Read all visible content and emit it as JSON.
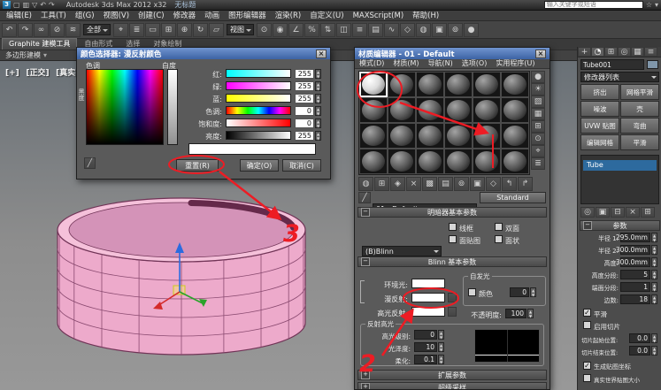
{
  "glyphs": {
    "close": "×",
    "star": "☆",
    "menu_arrow": "▾",
    "eyedropper": "╱",
    "logo": "3"
  },
  "colors": {
    "annotation_red": "#ed1c24",
    "object_pink": "#edaacb",
    "selection_blue": "#2d6a9e",
    "title_blue": "#3c63a4"
  },
  "title_bar": {
    "product": "Autodesk 3ds Max 2012 x32",
    "document": "无标题",
    "search_placeholder": "输入关键字或短语",
    "qat": [
      "▢",
      "▥",
      "▽",
      "↶",
      "↷"
    ]
  },
  "menu_bar": {
    "items": [
      "编辑(E)",
      "工具(T)",
      "组(G)",
      "视图(V)",
      "创建(C)",
      "修改器",
      "动画",
      "图形编辑器",
      "渲染(R)",
      "自定义(U)",
      "MAXScript(M)",
      "帮助(H)"
    ]
  },
  "toolbar": {
    "filter_value": "全部",
    "coord_value": "视图",
    "icons": [
      "↶",
      "↷",
      "∞",
      "⊘",
      "≋",
      "⌖",
      "≣",
      "▭",
      "⊞",
      "⊕",
      "↻",
      "▱",
      "⊙",
      "◉",
      "∠",
      "%",
      "⇅",
      "◫",
      "≡",
      "▤",
      "∿",
      "◇",
      "◍",
      "▣",
      "⊚",
      "●"
    ]
  },
  "ribbon": {
    "tabs": [
      "Graphite 建模工具",
      "自由形式",
      "选择",
      "对象绘制"
    ],
    "panel": "多边形建模"
  },
  "viewport": {
    "menu": "[+]",
    "view": "[正交]",
    "shading": "[真实 + 边面]",
    "object_color": "#edaacb"
  },
  "color_picker": {
    "title": "颜色选择器: 漫反射颜色",
    "hue_label": "色调",
    "white_label": "白度",
    "black_label": "黑度",
    "sliders": [
      {
        "label": "红:",
        "value": "255"
      },
      {
        "label": "绿:",
        "value": "255"
      },
      {
        "label": "蓝:",
        "value": "255"
      },
      {
        "label": "色调:",
        "value": "0"
      },
      {
        "label": "饱和度:",
        "value": "0"
      },
      {
        "label": "亮度:",
        "value": "255"
      }
    ],
    "reset": "重置(R)",
    "ok": "确定(O)",
    "cancel": "取消(C)"
  },
  "material_editor": {
    "title": "材质编辑器 - 01 - Default",
    "menus": [
      "模式(D)",
      "材质(M)",
      "导航(N)",
      "选项(O)",
      "实用程序(U)"
    ],
    "side_icons": [
      "●",
      "☀",
      "▨",
      "▦",
      "⊞",
      "⊙",
      "⌖",
      "≣"
    ],
    "tool_icons": [
      "◍",
      "⊞",
      "◈",
      "×",
      "▩",
      "▤",
      "⊚",
      "▣",
      "◇",
      "↰",
      "↱"
    ],
    "name_value": "01 - Default",
    "type_button": "Standard",
    "rollout_shader": "明暗器基本参数",
    "shader_type": "(B)Blinn",
    "cb_wire": "线框",
    "cb_twosided": "双面",
    "cb_facemap": "面贴图",
    "cb_faceted": "面状",
    "rollout_blinn": "Blinn 基本参数",
    "ambient": "环境光:",
    "diffuse": "漫反射:",
    "specular": "高光反射:",
    "selfillum_group": "自发光",
    "selfillum_cb": "颜色",
    "selfillum_value": "0",
    "opacity_label": "不透明度:",
    "opacity_value": "100",
    "highlight_group": "反射高光",
    "spec_level_label": "高光级别:",
    "spec_level_value": "0",
    "gloss_label": "光泽度:",
    "gloss_value": "10",
    "soften_label": "柔化:",
    "soften_value": "0.1",
    "rollout_extended": "扩展参数",
    "rollout_supersampling": "超级采样"
  },
  "command_panel": {
    "tab_icons": [
      "+",
      "◔",
      "⊞",
      "◎",
      "▦",
      "≡"
    ],
    "object_name": "Tube001",
    "modifier_list_label": "修改器列表",
    "modifier_buttons": [
      "挤出",
      "网格平滑",
      "噪波",
      "壳",
      "UVW 贴图",
      "弯曲",
      "编辑网格",
      "平滑"
    ],
    "stack_item": "Tube",
    "stack_icons": [
      "◎",
      "▣",
      "⊟",
      "×",
      "⊞"
    ],
    "rollout_params": "参数",
    "params": [
      {
        "label": "半径 1:",
        "value": "295.0mm"
      },
      {
        "label": "半径 2:",
        "value": "300.0mm"
      },
      {
        "label": "高度:",
        "value": "300.0mm"
      },
      {
        "label": "高度分段:",
        "value": "5"
      },
      {
        "label": "端面分段:",
        "value": "1"
      },
      {
        "label": "边数:",
        "value": "18"
      }
    ],
    "cb_smooth": "平滑",
    "cb_slice": "启用切片",
    "slice_from_label": "切片起始位置:",
    "slice_from_value": "0.0",
    "slice_to_label": "切片结束位置:",
    "slice_to_value": "0.0",
    "cb_genmap": "生成贴图坐标",
    "cb_realworld": "真实世界贴图大小"
  },
  "annotations": {
    "step2": "2",
    "step3": "3"
  }
}
